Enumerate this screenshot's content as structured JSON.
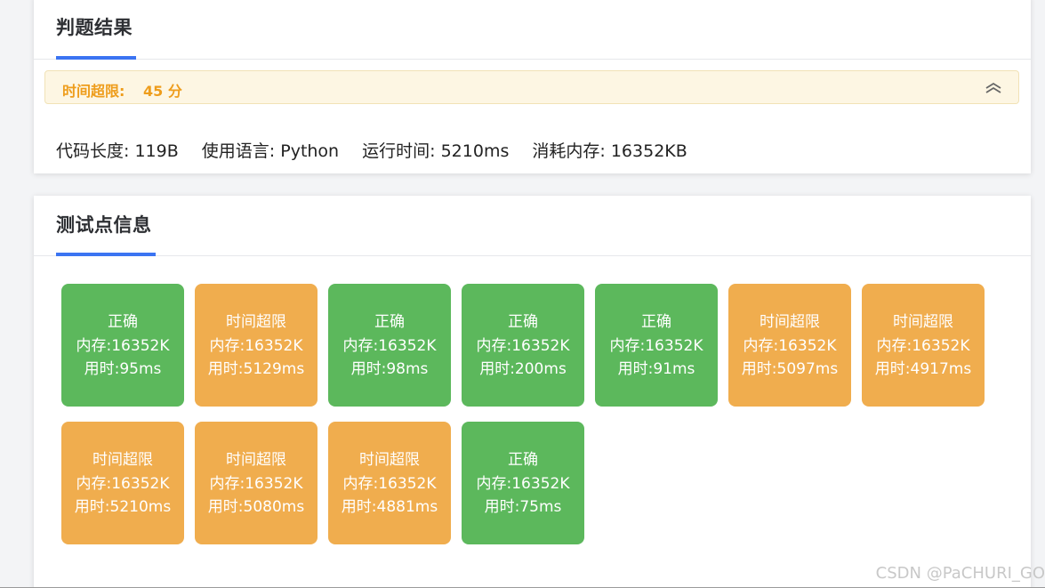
{
  "result_card": {
    "title": "判题结果",
    "verdict": "时间超限:",
    "score": "45 分",
    "meta": {
      "code_length": "代码长度: 119B",
      "language": "使用语言: Python",
      "run_time": "运行时间: 5210ms",
      "memory": "消耗内存: 16352KB"
    }
  },
  "tests_card": {
    "title": "测试点信息",
    "cases": [
      {
        "status": "正确",
        "memory": "内存:16352K",
        "time": "用时:95ms",
        "kind": "ok"
      },
      {
        "status": "时间超限",
        "memory": "内存:16352K",
        "time": "用时:5129ms",
        "kind": "tle"
      },
      {
        "status": "正确",
        "memory": "内存:16352K",
        "time": "用时:98ms",
        "kind": "ok"
      },
      {
        "status": "正确",
        "memory": "内存:16352K",
        "time": "用时:200ms",
        "kind": "ok"
      },
      {
        "status": "正确",
        "memory": "内存:16352K",
        "time": "用时:91ms",
        "kind": "ok"
      },
      {
        "status": "时间超限",
        "memory": "内存:16352K",
        "time": "用时:5097ms",
        "kind": "tle"
      },
      {
        "status": "时间超限",
        "memory": "内存:16352K",
        "time": "用时:4917ms",
        "kind": "tle"
      },
      {
        "status": "时间超限",
        "memory": "内存:16352K",
        "time": "用时:5210ms",
        "kind": "tle"
      },
      {
        "status": "时间超限",
        "memory": "内存:16352K",
        "time": "用时:5080ms",
        "kind": "tle"
      },
      {
        "status": "时间超限",
        "memory": "内存:16352K",
        "time": "用时:4881ms",
        "kind": "tle"
      },
      {
        "status": "正确",
        "memory": "内存:16352K",
        "time": "用时:75ms",
        "kind": "ok"
      }
    ]
  },
  "watermark": "CSDN @PaCHURI_GO",
  "colors": {
    "accent": "#3b74f2",
    "ok": "#5cb85c",
    "tle": "#f0ad4e",
    "verdict_text": "#ee9d1c",
    "verdict_bg": "#fdf6e3"
  },
  "icons": {
    "collapse": "double-chevron-up-icon"
  }
}
